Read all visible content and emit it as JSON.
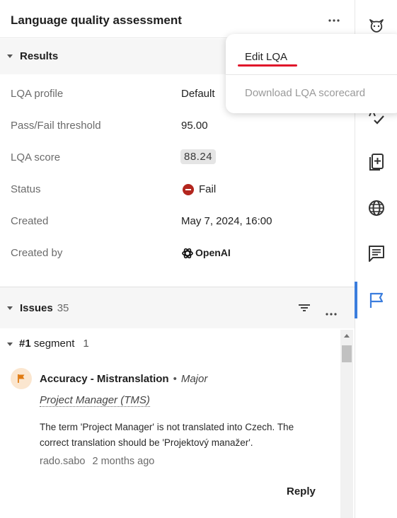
{
  "header": {
    "title": "Language quality assessment",
    "more_icon": "ellipsis-icon"
  },
  "menu": {
    "edit_label": "Edit LQA",
    "download_label": "Download LQA scorecard"
  },
  "results": {
    "label": "Results",
    "rows": [
      {
        "label": "LQA profile",
        "value": "Default"
      },
      {
        "label": "Pass/Fail threshold",
        "value": "95.00"
      },
      {
        "label": "LQA score",
        "value": "88.24"
      },
      {
        "label": "Status",
        "value": "Fail"
      },
      {
        "label": "Created",
        "value": "May 7, 2024, 16:00"
      },
      {
        "label": "Created by",
        "value": "OpenAI"
      }
    ]
  },
  "issues": {
    "label": "Issues",
    "count": "35",
    "segment": {
      "number": "#1",
      "word": "segment",
      "count": "1"
    },
    "item": {
      "category": "Accuracy - Mistranslation",
      "separator": "•",
      "severity": "Major",
      "term": "Project Manager (TMS)",
      "description": "The term 'Project Manager' is not translated into Czech. The correct translation should be 'Projektový manažer'.",
      "author": "rado.sabo",
      "time": "2 months ago",
      "reply_label": "Reply"
    }
  },
  "colors": {
    "accent": "#3b7ddd",
    "fail": "#b3261e",
    "flag": "#e07b12",
    "underline": "#e0142a"
  },
  "rail": {
    "icons": [
      "cat-icon",
      "spellcheck-icon",
      "clipboard-add-icon",
      "globe-icon",
      "comment-icon",
      "flag-icon"
    ]
  }
}
